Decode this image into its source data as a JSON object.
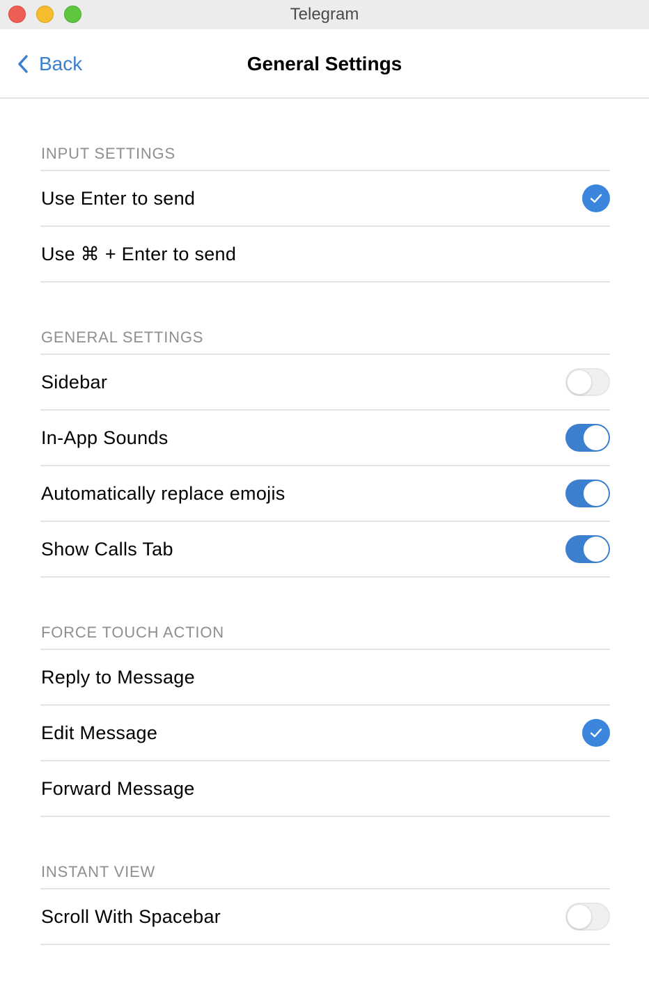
{
  "window": {
    "title": "Telegram"
  },
  "nav": {
    "back_label": "Back",
    "title": "General Settings"
  },
  "sections": [
    {
      "header": "INPUT SETTINGS",
      "rows": [
        {
          "label": "Use Enter to send",
          "control": "check",
          "checked": true
        },
        {
          "label": "Use ⌘ + Enter to send",
          "control": "check",
          "checked": false
        }
      ]
    },
    {
      "header": "GENERAL SETTINGS",
      "rows": [
        {
          "label": "Sidebar",
          "control": "toggle",
          "on": false
        },
        {
          "label": "In-App Sounds",
          "control": "toggle",
          "on": true
        },
        {
          "label": "Automatically replace emojis",
          "control": "toggle",
          "on": true
        },
        {
          "label": "Show Calls Tab",
          "control": "toggle",
          "on": true
        }
      ]
    },
    {
      "header": "FORCE TOUCH ACTION",
      "rows": [
        {
          "label": "Reply to Message",
          "control": "check",
          "checked": false
        },
        {
          "label": "Edit Message",
          "control": "check",
          "checked": true
        },
        {
          "label": "Forward Message",
          "control": "check",
          "checked": false
        }
      ]
    },
    {
      "header": "INSTANT VIEW",
      "rows": [
        {
          "label": "Scroll With Spacebar",
          "control": "toggle",
          "on": false
        }
      ]
    }
  ],
  "colors": {
    "accent": "#3b86dc",
    "separator": "#e3e3e3",
    "section_text": "#8e8e93"
  }
}
